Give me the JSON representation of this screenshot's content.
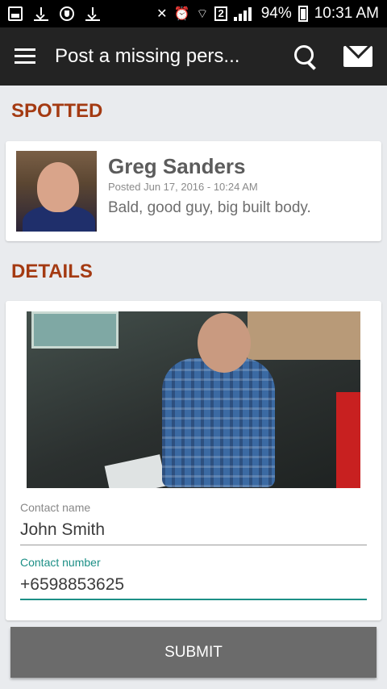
{
  "status_bar": {
    "battery_percent": "94%",
    "time": "10:31 AM",
    "sim_badge": "2",
    "icons": [
      "image-icon",
      "download-icon",
      "shield-icon",
      "download-icon",
      "mute-icon",
      "alarm-icon",
      "wifi-icon",
      "signal-icon",
      "battery-icon"
    ]
  },
  "app_bar": {
    "title": "Post a missing pers...",
    "icons": [
      "menu-icon",
      "search-icon",
      "mail-icon"
    ]
  },
  "spotted": {
    "heading": "SPOTTED",
    "name": "Greg Sanders",
    "posted": "Posted Jun 17, 2016 - 10:24 AM",
    "description": "Bald, good guy, big built body."
  },
  "details": {
    "heading": "DETAILS",
    "contact_name_label": "Contact name",
    "contact_name_value": "John Smith",
    "contact_number_label": "Contact number",
    "contact_number_value": "+6598853625"
  },
  "submit_label": "SUBMIT",
  "colors": {
    "accent": "#a43a12",
    "teal": "#1c8f86",
    "appbar": "#232323",
    "button": "#6b6b6b"
  }
}
